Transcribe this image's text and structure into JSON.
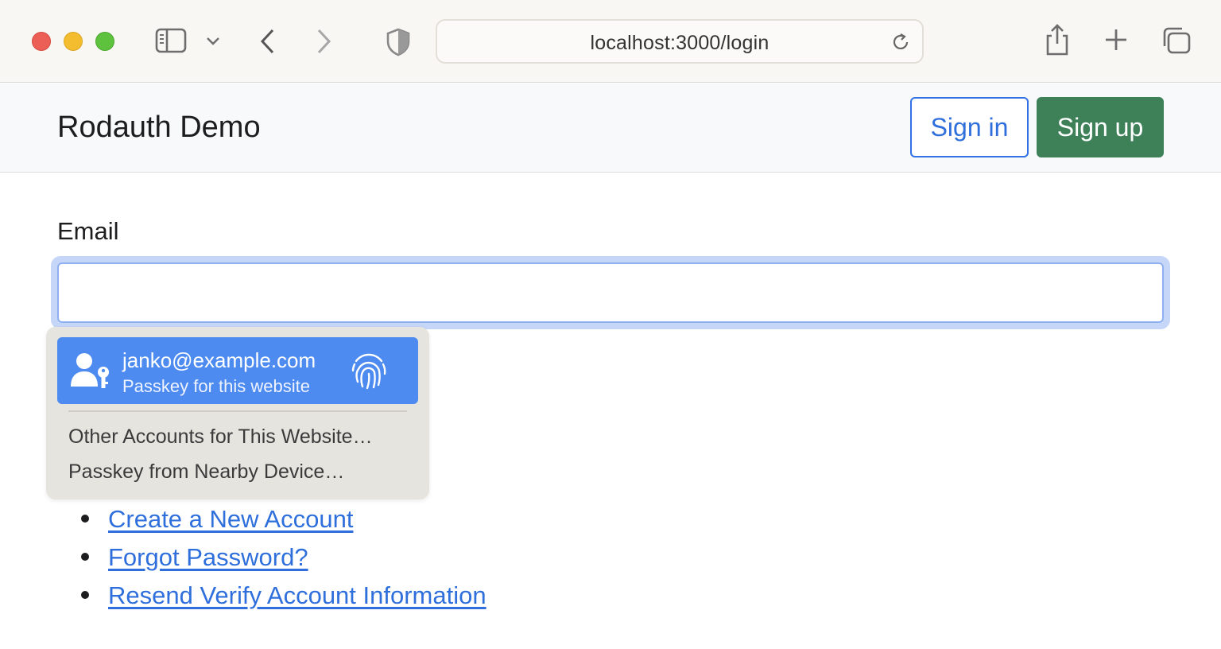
{
  "browser": {
    "url": "localhost:3000/login"
  },
  "navbar": {
    "brand": "Rodauth Demo",
    "sign_in_label": "Sign in",
    "sign_up_label": "Sign up"
  },
  "form": {
    "email_label": "Email",
    "email_value": ""
  },
  "autofill": {
    "passkey_account": "janko@example.com",
    "passkey_subtitle": "Passkey for this website",
    "other_accounts": "Other Accounts for This Website…",
    "nearby_device": "Passkey from Nearby Device…"
  },
  "links": [
    "Create a New Account",
    "Forgot Password?",
    "Resend Verify Account Information"
  ],
  "colors": {
    "accent_blue": "#2f6fdc",
    "success_green": "#3e8159",
    "passkey_highlight": "#4d8bf0"
  },
  "icons": {
    "sidebar": "sidebar-icon",
    "back": "chevron-left-icon",
    "forward": "chevron-right-icon",
    "privacy": "shield-icon",
    "reload": "reload-icon",
    "share": "share-icon",
    "new_tab": "plus-icon",
    "tabs": "tabs-overview-icon",
    "key": "key-icon",
    "passkey_user": "user-key-icon",
    "fingerprint": "fingerprint-icon"
  }
}
